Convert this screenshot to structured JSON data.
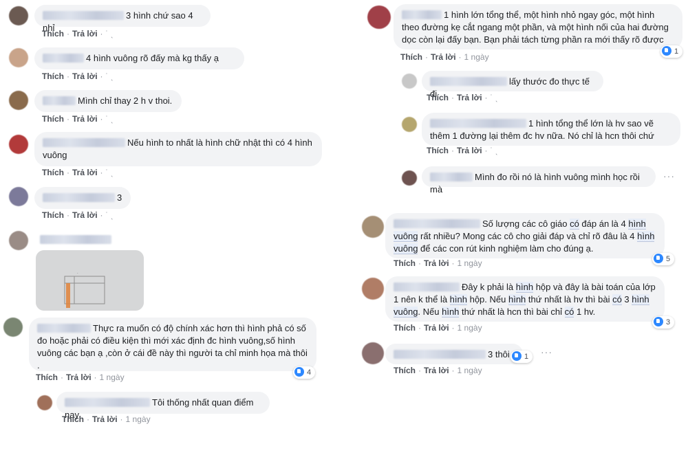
{
  "actions": {
    "like": "Thích",
    "reply": "Trả lời",
    "time": "1 ngày"
  },
  "left": [
    {
      "text": "3 hình chứ sao 4 nhỉ"
    },
    {
      "text": "4 hình vuông rõ đấy mà kg thấy ạ"
    },
    {
      "text": "Mình chỉ thay 2 h v thoi."
    },
    {
      "text": "Nếu hình to nhất là hình chữ nhật thì có 4 hình vuông"
    },
    {
      "text": "3"
    },
    {
      "text": "Thực ra muốn có độ chính xác hơn thì hình phả có số đo hoặc phải có điều kiện thì mới xác định đc hình vuông,số hình vuông các bạn ạ ,còn ở cái đề này thì người ta chỉ minh họa mà thôi .",
      "likes": "4"
    },
    {
      "text": "Tôi thống nhất quan điểm nay"
    }
  ],
  "right": [
    {
      "text": "1 hình lớn tổng thể, một hình nhỏ ngay góc, một hình theo đường kẹ cắt ngang một phần, và một hình nối của hai đường dọc còn lại đấy bạn. Bạn phải tách từng phần ra mới thấy rõ được",
      "likes": "1"
    },
    {
      "text": "lấy thước đo thực tế đi"
    },
    {
      "text": "1 hình tổng thể lớn là hv sao vẽ thêm 1 đường lại thêm đc hv nữa. Nó chỉ là hcn thôi chứ"
    },
    {
      "text": "Mình đo rồi nó là hình vuông mình học rồi mà"
    },
    {
      "t1": "Số lượng các cô giáo ",
      "h1": "có",
      "t2": " đáp án là 4 ",
      "h2": "hình vuông",
      "t3": " rất nhiều? Mong các cô cho giải đáp và chỉ rõ đâu là 4 ",
      "h3": "hình vuông",
      "t4": " để các con rút kinh nghiệm làm cho đúng ạ.",
      "likes": "5"
    },
    {
      "t1": "Đây k phải là ",
      "h1": "hình",
      "t2": " hộp và đây là bài toán của lớp 1 nên k thể là ",
      "h2": "hình",
      "t3": " hộp. Nếu ",
      "h3": "hình",
      "t4": " thứ nhất là hv thì bài ",
      "h4": "có",
      "t5": " 3 ",
      "h5": "hình vuông",
      "t6": ". Nếu ",
      "h6": "hình",
      "t7": " thứ nhất là hcn thì bài chỉ ",
      "h7": "có",
      "t8": " 1 hv.",
      "likes": "3"
    },
    {
      "text": "3 thôi",
      "likes": "1"
    }
  ],
  "colors": {
    "like_blue": "#2d88ff",
    "bubble": "#f2f3f5",
    "action_gray": "#90949c"
  }
}
